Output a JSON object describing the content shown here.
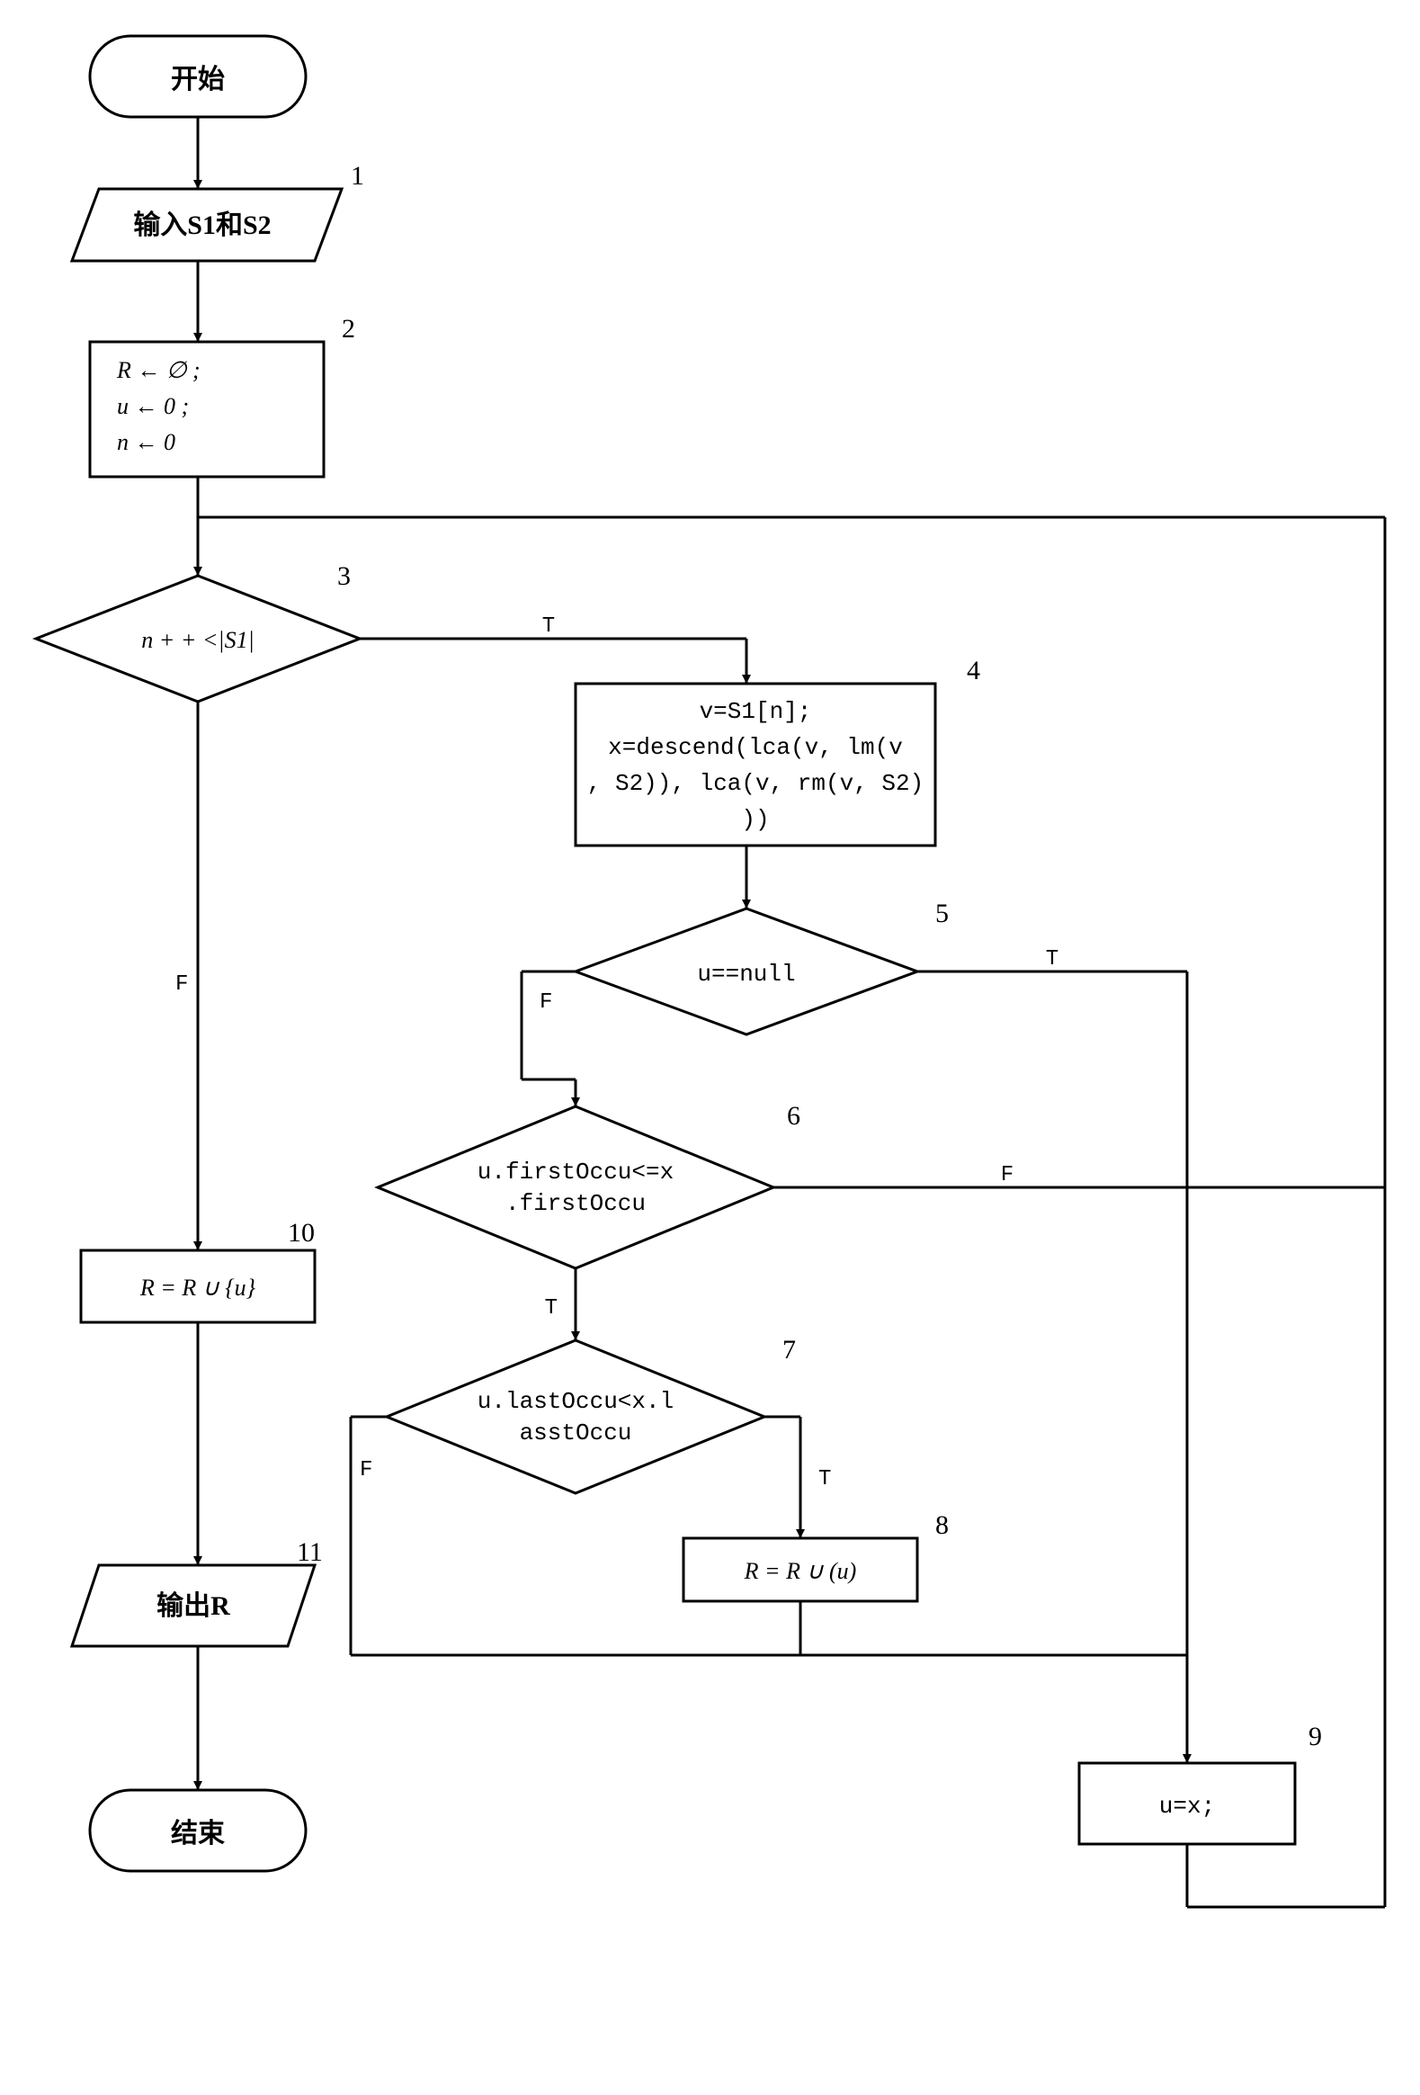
{
  "nodes": {
    "start": {
      "label": "开始"
    },
    "input": {
      "label": "输入S1和S2",
      "num": "1"
    },
    "init": {
      "lines": [
        "R  ←    ∅ ;",
        "u  ←    0 ;",
        "n  ←    0"
      ],
      "num": "2"
    },
    "cond_n": {
      "label": "n + + <|S1|",
      "num": "3"
    },
    "compute": {
      "lines": [
        "v=S1[n];",
        "x=descend(lca(v, lm(v",
        ", S2)), lca(v, rm(v, S2)",
        "))"
      ],
      "num": "4"
    },
    "cond_null": {
      "label": "u==null",
      "num": "5"
    },
    "cond_first": {
      "lines": [
        "u.firstOccu<=x",
        ".firstOccu"
      ],
      "num": "6"
    },
    "cond_last": {
      "lines": [
        "u.lastOccu<x.l",
        "asstOccu"
      ],
      "num": "7"
    },
    "union8": {
      "label": "R = R ∪ (u)",
      "num": "8"
    },
    "assign9": {
      "label": "u=x;",
      "num": "9"
    },
    "union10": {
      "label": "R = R ∪ {u}",
      "num": "10"
    },
    "output": {
      "label": "输出R",
      "num": "11"
    },
    "end": {
      "label": "结束"
    }
  },
  "edge_labels": {
    "true": "T",
    "false": "F"
  }
}
